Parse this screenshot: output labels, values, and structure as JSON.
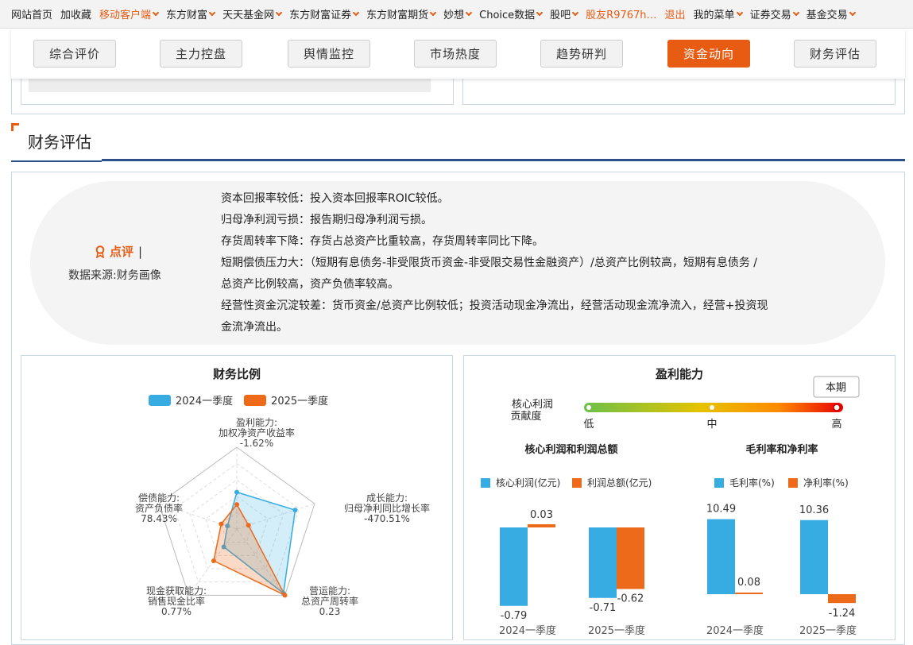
{
  "topnav": [
    {
      "label": "网站首页",
      "orange": false,
      "chev": false
    },
    {
      "label": "加收藏",
      "orange": false,
      "chev": false
    },
    {
      "label": "移动客户端",
      "orange": true,
      "chev": true
    },
    {
      "label": "东方财富",
      "orange": false,
      "chev": true
    },
    {
      "label": "天天基金网",
      "orange": false,
      "chev": true
    },
    {
      "label": "东方财富证券",
      "orange": false,
      "chev": true
    },
    {
      "label": "东方财富期货",
      "orange": false,
      "chev": true
    },
    {
      "label": "妙想",
      "orange": false,
      "chev": true
    },
    {
      "label": "Choice数据",
      "orange": false,
      "chev": true
    },
    {
      "label": "股吧",
      "orange": false,
      "chev": true
    },
    {
      "label": "股友R9767h…",
      "orange": true,
      "chev": false
    },
    {
      "label": "退出",
      "orange": true,
      "chev": false
    },
    {
      "label": "我的菜单",
      "orange": false,
      "chev": true
    },
    {
      "label": "证券交易",
      "orange": false,
      "chev": true
    },
    {
      "label": "基金交易",
      "orange": false,
      "chev": true
    }
  ],
  "tabs": [
    {
      "label": "综合评价",
      "active": false
    },
    {
      "label": "主力控盘",
      "active": false
    },
    {
      "label": "舆情监控",
      "active": false
    },
    {
      "label": "市场热度",
      "active": false
    },
    {
      "label": "趋势研判",
      "active": false
    },
    {
      "label": "资金动向",
      "active": true
    },
    {
      "label": "财务评估",
      "active": false
    }
  ],
  "section": {
    "title": "财务评估"
  },
  "review": {
    "title": "点评",
    "source": "数据来源:财务画像",
    "lines": [
      "资本回报率较低：投入资本回报率ROIC较低。",
      "归母净利润亏损：报告期归母净利润亏损。",
      "存货周转率下降：存货占总资产比重较高，存货周转率同比下降。",
      "短期偿债压力大：（短期有息债务-非受限货币资金-非受限交易性金融资产）/总资产比例较高，短期有息债务 /",
      "总资产比例较高，资产负债率较高。",
      "经营性资金沉淀较差：货币资金/总资产比例较低；投资活动现金净流出，经营活动现金流净流入，经营+投资现",
      "金流净流出。"
    ]
  },
  "ratio_panel": {
    "title": "财务比例",
    "legend": [
      "2024一季度",
      "2025一季度"
    ],
    "colors": {
      "s2024": "#36ace3",
      "s2025": "#ec6a1a"
    },
    "axes": [
      {
        "l1": "盈利能力:",
        "l2": "加权净资产收益率",
        "value": "-1.62%"
      },
      {
        "l1": "成长能力:",
        "l2": "归母净利同比增长率",
        "value": "-470.51%"
      },
      {
        "l1": "营运能力:",
        "l2": "总资产周转率",
        "value": "0.23"
      },
      {
        "l1": "现金获取能力:",
        "l2": "销售现金比率",
        "value": "0.77%"
      },
      {
        "l1": "偿债能力:",
        "l2": "资产负债率",
        "value": "78.43%"
      }
    ]
  },
  "profit_panel": {
    "title": "盈利能力",
    "contribution_label_1": "核心利润",
    "contribution_label_2": "贡献度",
    "scale": [
      "低",
      "中",
      "高"
    ],
    "current_tag": "本期",
    "sub1_title": "核心利润和利润总额",
    "sub2_title": "毛利率和净利率",
    "sub1_legend": [
      "核心利润(亿元)",
      "利润总额(亿元)"
    ],
    "sub2_legend": [
      "毛利率(%)",
      "净利率(%)"
    ],
    "categories": [
      "2024一季度",
      "2025一季度"
    ]
  },
  "chart_data": [
    {
      "type": "radar",
      "title": "财务比例",
      "series": [
        {
          "name": "2024一季度",
          "values": [
            0.45,
            0.75,
            0.97,
            0.27,
            0.12
          ]
        },
        {
          "name": "2025一季度",
          "values": [
            0.3,
            0.15,
            1.0,
            0.48,
            0.2
          ]
        }
      ]
    },
    {
      "type": "bar",
      "title": "核心利润和利润总额",
      "categories": [
        "2024一季度",
        "2025一季度"
      ],
      "series": [
        {
          "name": "核心利润(亿元)",
          "values": [
            -0.79,
            -0.71
          ]
        },
        {
          "name": "利润总额(亿元)",
          "values": [
            0.03,
            -0.62
          ]
        }
      ]
    },
    {
      "type": "bar",
      "title": "毛利率和净利率",
      "categories": [
        "2024一季度",
        "2025一季度"
      ],
      "series": [
        {
          "name": "毛利率(%)",
          "values": [
            10.49,
            10.36
          ]
        },
        {
          "name": "净利率(%)",
          "values": [
            0.08,
            -1.24
          ]
        }
      ]
    }
  ]
}
